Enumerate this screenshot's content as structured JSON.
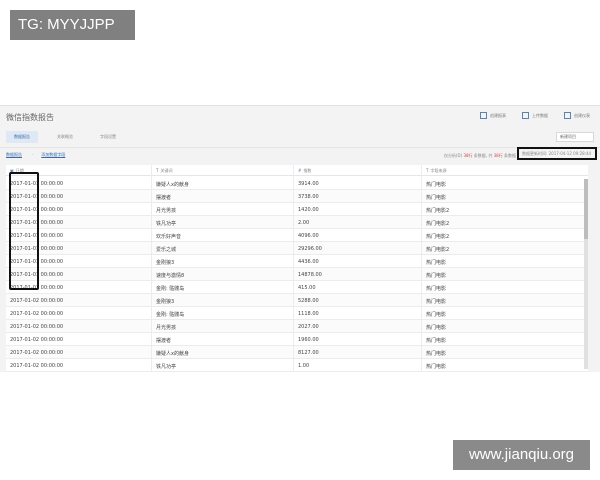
{
  "watermark_tag": "TG: MYYJJPP",
  "watermark_url": "www.jianqiu.org",
  "app": {
    "title": "微信指数报告",
    "actions": [
      {
        "label": "创建报表",
        "icon": "report-icon"
      },
      {
        "label": "上传数据",
        "icon": "upload-icon"
      },
      {
        "label": "创建仪表",
        "icon": "dashboard-icon"
      }
    ],
    "tabs": [
      {
        "label": "数据报告",
        "active": true
      },
      {
        "label": "关联概览",
        "active": false
      },
      {
        "label": "字段设置",
        "active": false
      }
    ],
    "project_select": "新建项目",
    "breadcrumb": [
      "数据报告",
      "添加数据字段"
    ],
    "filter_info": {
      "prefix": "仅分析(D) ",
      "count_a": "38行",
      "mid": " 条数据, 共 ",
      "count_b": "38行",
      "suffix": " 条数据"
    },
    "updated_text": "数据更新时间: 2017-04-12 09:28:44"
  },
  "grid": {
    "headers": [
      "日期",
      "关键词",
      "指数",
      "字段来源"
    ],
    "rows": [
      {
        "date": "2017-01-01 00:00:00",
        "keyword": "嫌疑人x的献身",
        "value": "3914.00",
        "source": "热门电影"
      },
      {
        "date": "2017-01-01 00:00:00",
        "keyword": "摆渡者",
        "value": "3738.00",
        "source": "热门电影"
      },
      {
        "date": "2017-01-01 00:00:00",
        "keyword": "月光男孩",
        "value": "1420.00",
        "source": "热门电影2"
      },
      {
        "date": "2017-01-01 00:00:00",
        "keyword": "铁凡功亭",
        "value": "2.00",
        "source": "热门电影2"
      },
      {
        "date": "2017-01-01 00:00:00",
        "keyword": "欢乐好声音",
        "value": "4096.00",
        "source": "热门电影2"
      },
      {
        "date": "2017-01-01 00:00:00",
        "keyword": "爱乐之城",
        "value": "29296.00",
        "source": "热门电影2"
      },
      {
        "date": "2017-01-01 00:00:00",
        "keyword": "金刚狼3",
        "value": "4436.00",
        "source": "热门电影"
      },
      {
        "date": "2017-01-01 00:00:00",
        "keyword": "速度与激情8",
        "value": "14878.00",
        "source": "热门电影"
      },
      {
        "date": "2017-01-01 00:00:00",
        "keyword": "金刚: 骷髅岛",
        "value": "415.00",
        "source": "热门电影"
      },
      {
        "date": "2017-01-02 00:00:00",
        "keyword": "金刚狼3",
        "value": "5288.00",
        "source": "热门电影"
      },
      {
        "date": "2017-01-02 00:00:00",
        "keyword": "金刚: 骷髅岛",
        "value": "1118.00",
        "source": "热门电影"
      },
      {
        "date": "2017-01-02 00:00:00",
        "keyword": "月光男孩",
        "value": "2027.00",
        "source": "热门电影"
      },
      {
        "date": "2017-01-02 00:00:00",
        "keyword": "摆渡者",
        "value": "1960.00",
        "source": "热门电影"
      },
      {
        "date": "2017-01-02 00:00:00",
        "keyword": "嫌疑人x的献身",
        "value": "8127.00",
        "source": "热门电影"
      },
      {
        "date": "2017-01-02 00:00:00",
        "keyword": "铁凡功亭",
        "value": "1.00",
        "source": "热门电影"
      }
    ]
  },
  "colors": {
    "accent": "#3a6aa8",
    "highlight": "#d04848",
    "frame": "#111111"
  }
}
